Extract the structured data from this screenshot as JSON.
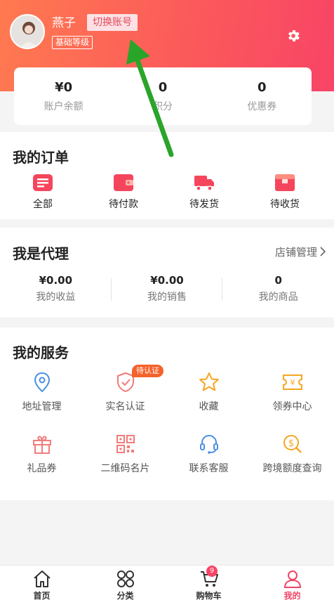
{
  "profile": {
    "name": "燕子",
    "switch_account": "切换账号",
    "level": "基础等级"
  },
  "stats": [
    {
      "value": "¥0",
      "label": "账户余额"
    },
    {
      "value": "0",
      "label": "积分"
    },
    {
      "value": "0",
      "label": "优惠券"
    }
  ],
  "orders": {
    "title": "我的订单",
    "items": [
      {
        "label": "全部",
        "icon": "list-icon"
      },
      {
        "label": "待付款",
        "icon": "wallet-icon"
      },
      {
        "label": "待发货",
        "icon": "truck-icon"
      },
      {
        "label": "待收货",
        "icon": "package-icon"
      }
    ]
  },
  "agent": {
    "title": "我是代理",
    "shop_link": "店铺管理",
    "cells": [
      {
        "value": "¥0.00",
        "label": "我的收益"
      },
      {
        "value": "¥0.00",
        "label": "我的销售"
      },
      {
        "value": "0",
        "label": "我的商品"
      }
    ]
  },
  "services": {
    "title": "我的服务",
    "badge": "待认证",
    "items": [
      {
        "label": "地址管理",
        "icon": "location-icon"
      },
      {
        "label": "实名认证",
        "icon": "shield-check-icon"
      },
      {
        "label": "收藏",
        "icon": "star-icon"
      },
      {
        "label": "领券中心",
        "icon": "coupon-icon"
      },
      {
        "label": "礼品券",
        "icon": "gift-icon"
      },
      {
        "label": "二维码名片",
        "icon": "qrcode-icon"
      },
      {
        "label": "联系客服",
        "icon": "headset-icon"
      },
      {
        "label": "跨境额度查询",
        "icon": "dollar-search-icon"
      }
    ]
  },
  "tabbar": {
    "items": [
      {
        "label": "首页",
        "icon": "home-icon"
      },
      {
        "label": "分类",
        "icon": "category-icon"
      },
      {
        "label": "购物车",
        "icon": "cart-icon"
      },
      {
        "label": "我的",
        "icon": "user-icon"
      }
    ],
    "cart_count": "9"
  },
  "colors": {
    "brand": "#f84466",
    "header_start": "#ff7a50",
    "badge": "#f4622c",
    "arrow": "#2aa52a"
  }
}
